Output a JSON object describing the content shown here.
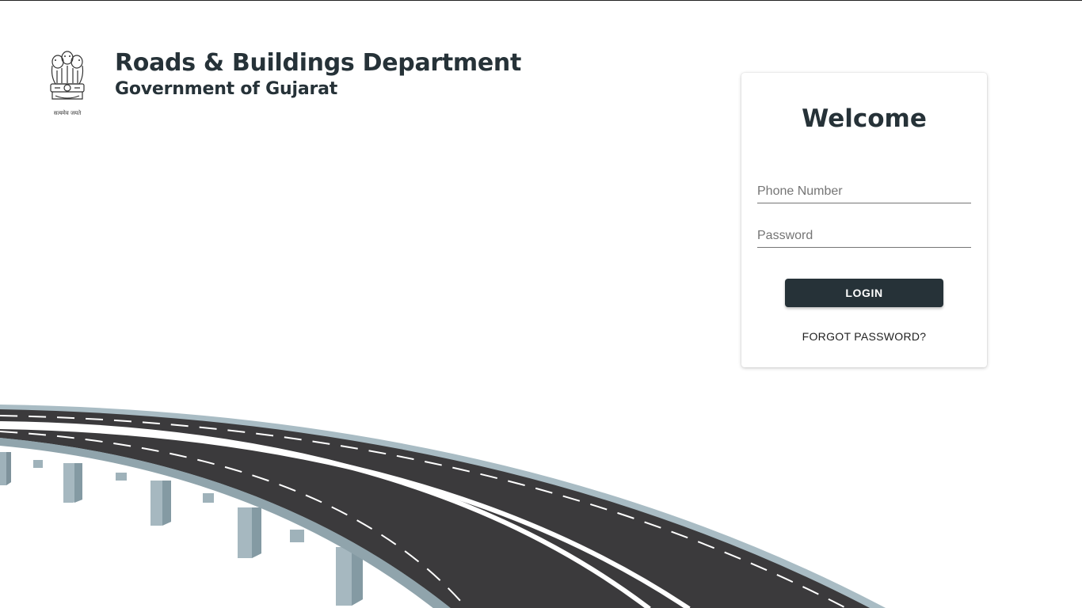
{
  "header": {
    "department": "Roads & Buildings Department",
    "government": "Government of Gujarat",
    "emblem_icon": "state-emblem-icon",
    "emblem_motto": "सत्यमेव जयते"
  },
  "login": {
    "welcome": "Welcome",
    "phone_placeholder": "Phone Number",
    "phone_value": "",
    "password_placeholder": "Password",
    "password_value": "",
    "login_label": "LOGIN",
    "forgot_label": "FORGOT PASSWORD?"
  },
  "colors": {
    "primary_text": "#263238",
    "button_bg": "#263238",
    "road_surface": "#3b3a3c",
    "road_edge": "#a7bac3"
  }
}
